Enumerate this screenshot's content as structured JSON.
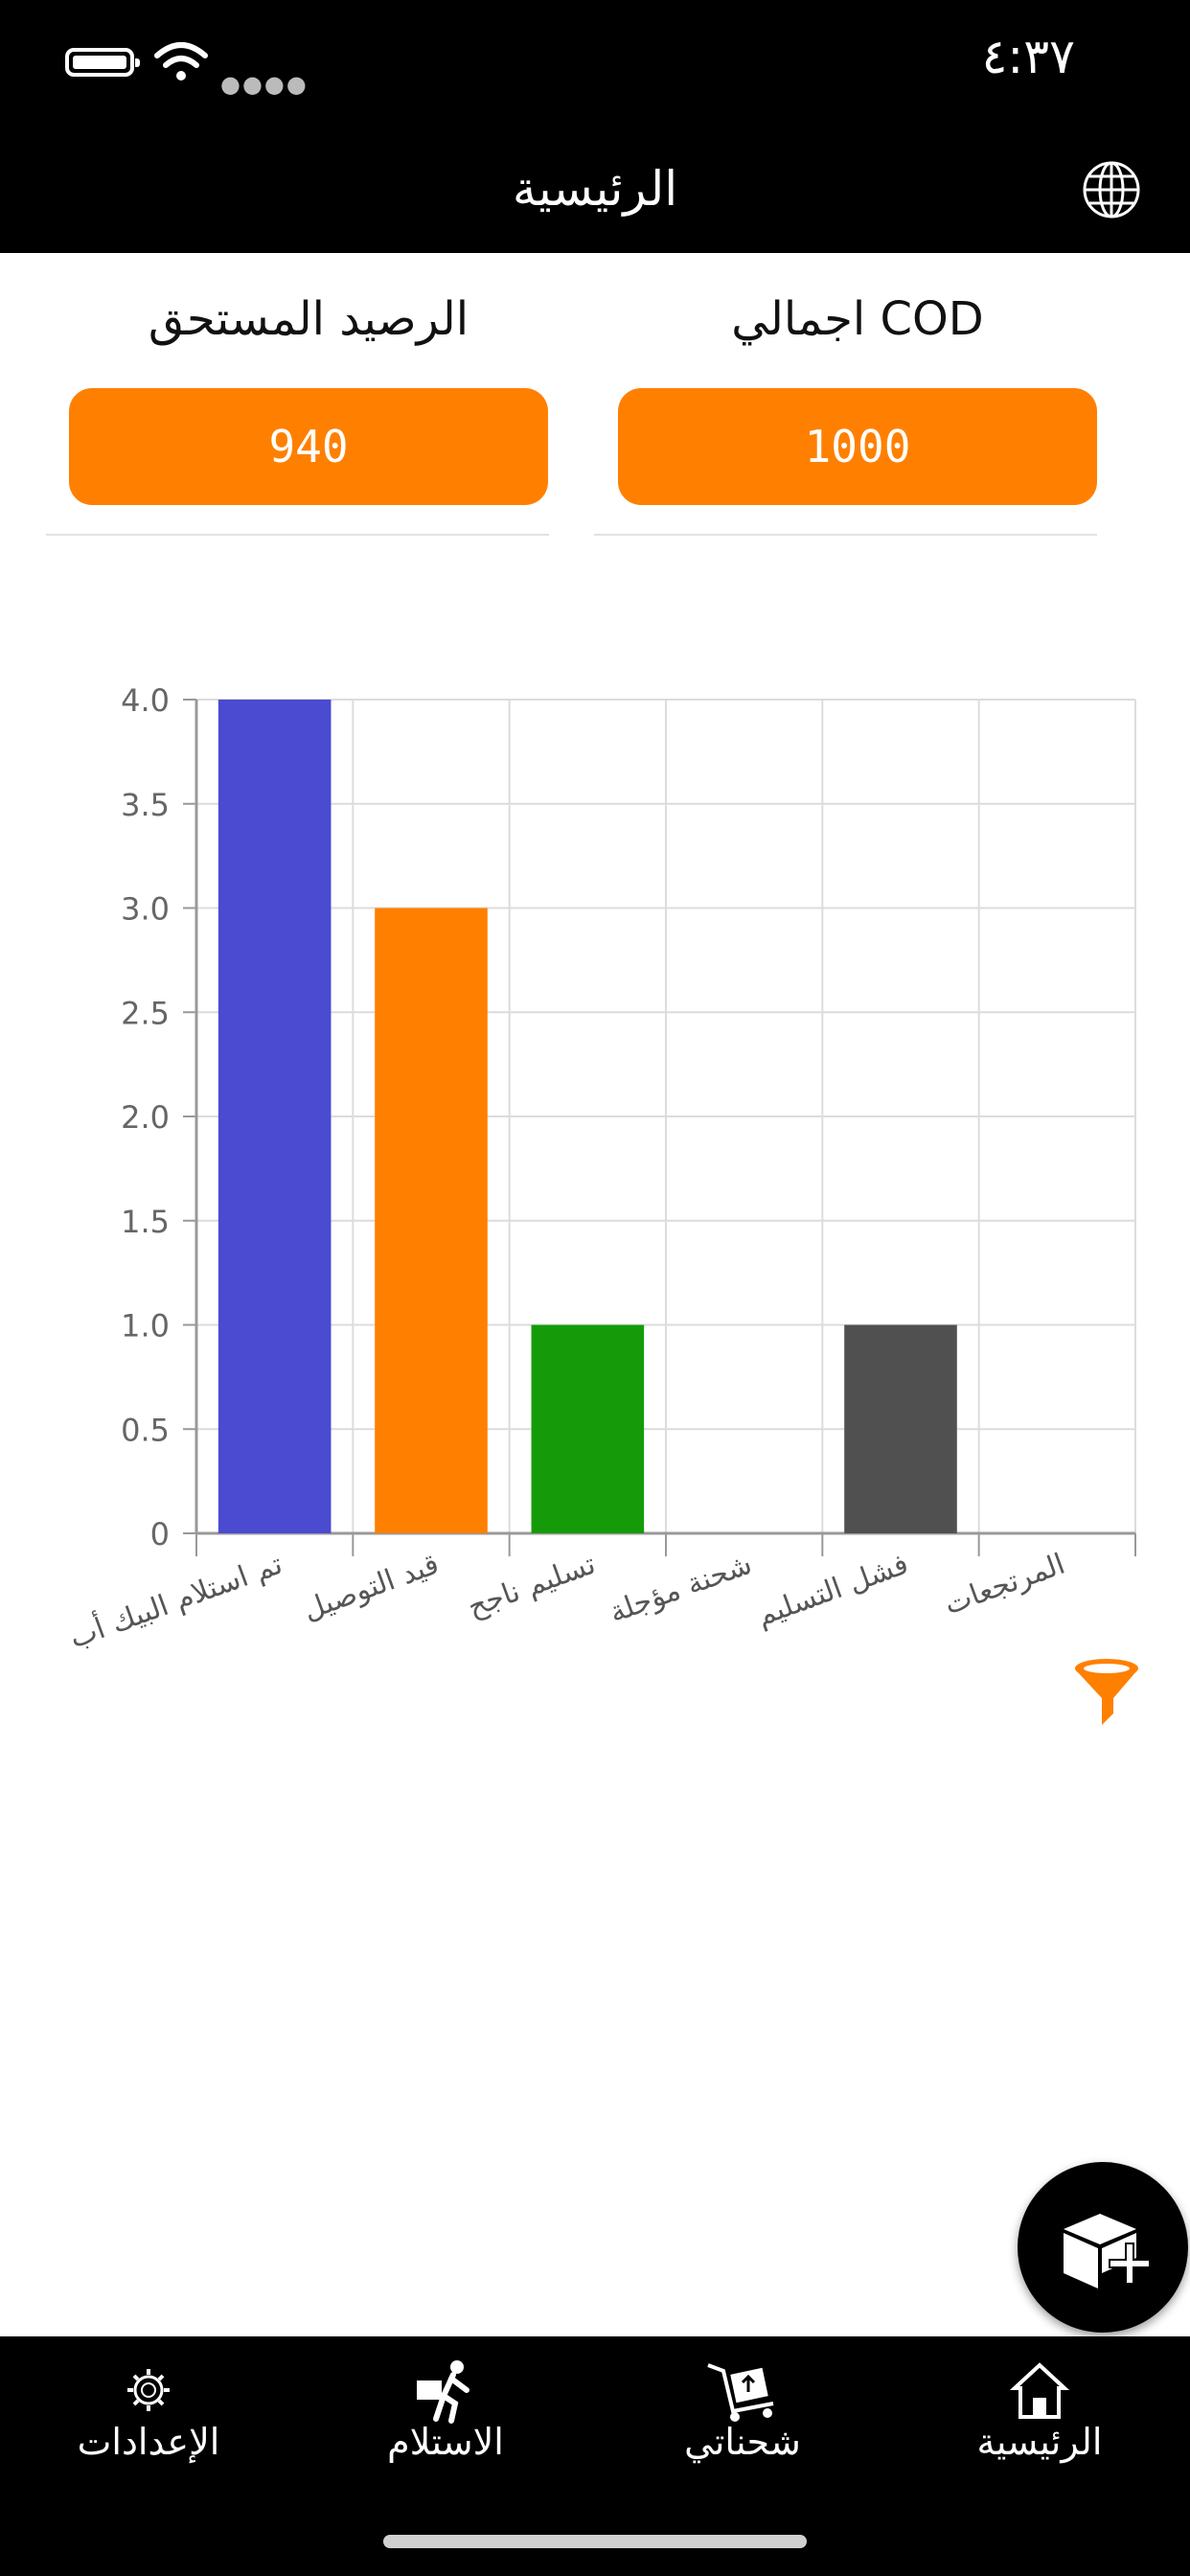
{
  "status_bar": {
    "time": "٤:٣٧"
  },
  "header": {
    "title": "الرئيسية"
  },
  "summary": {
    "cod_label": "اجمالي COD",
    "cod_value": "1000",
    "balance_label": "الرصيد المستحق",
    "balance_value": "940"
  },
  "chart_data": {
    "type": "bar",
    "categories": [
      "تم استلام البيك أب",
      "قيد التوصيل",
      "تسليم ناجح",
      "شحنة مؤجلة",
      "فشل التسليم",
      "المرتجعات"
    ],
    "values": [
      4,
      3,
      1,
      0,
      1,
      0
    ],
    "colors": [
      "#4a4bd0",
      "#ff8000",
      "#159b09",
      "#999999",
      "#505050",
      "#999999"
    ],
    "ylim": [
      0,
      4
    ],
    "yticks": [
      "0",
      "0.5",
      "1.0",
      "1.5",
      "2.0",
      "2.5",
      "3.0",
      "3.5",
      "4.0"
    ],
    "grid": true
  },
  "tabs": [
    {
      "label": "الرئيسية",
      "icon": "home-icon"
    },
    {
      "label": "شحناتي",
      "icon": "shipments-cart-icon"
    },
    {
      "label": "الاستلام",
      "icon": "pickup-person-icon"
    },
    {
      "label": "الإعدادات",
      "icon": "gear-icon"
    }
  ],
  "theme": {
    "accent": "#ff8000",
    "bar_background": "#000000"
  }
}
